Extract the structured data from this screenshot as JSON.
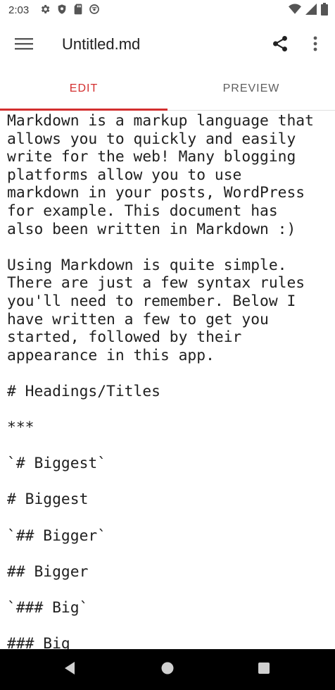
{
  "status_bar": {
    "time": "2:03",
    "icons_left": [
      "settings-icon",
      "shield-icon",
      "sd-card-icon",
      "do-not-disturb-icon"
    ],
    "icons_right": [
      "wifi-icon",
      "signal-icon",
      "battery-icon"
    ]
  },
  "app_bar": {
    "title": "Untitled.md",
    "menu_icon": "hamburger-menu-icon",
    "share_icon": "share-icon",
    "more_icon": "more-vert-icon"
  },
  "tabs": {
    "edit_label": "EDIT",
    "preview_label": "PREVIEW",
    "active": "edit"
  },
  "editor": {
    "content": "Markdown is a markup language that\nallows you to quickly and easily\nwrite for the web! Many blogging\nplatforms allow you to use\nmarkdown in your posts, WordPress\nfor example. This document has\nalso been written in Markdown :)\n\nUsing Markdown is quite simple.\nThere are just a few syntax rules\nyou'll need to remember. Below I\nhave written a few to get you\nstarted, followed by their\nappearance in this app.\n\n# Headings/Titles\n\n***\n\n`# Biggest`\n\n# Biggest\n\n`## Bigger`\n\n## Bigger\n\n`### Big`\n\n### Big"
  },
  "nav_bar": {
    "back_icon": "back-icon",
    "home_icon": "home-icon",
    "recents_icon": "recents-icon"
  },
  "colors": {
    "accent": "#d32f2f",
    "nav_bar": "#000000"
  }
}
